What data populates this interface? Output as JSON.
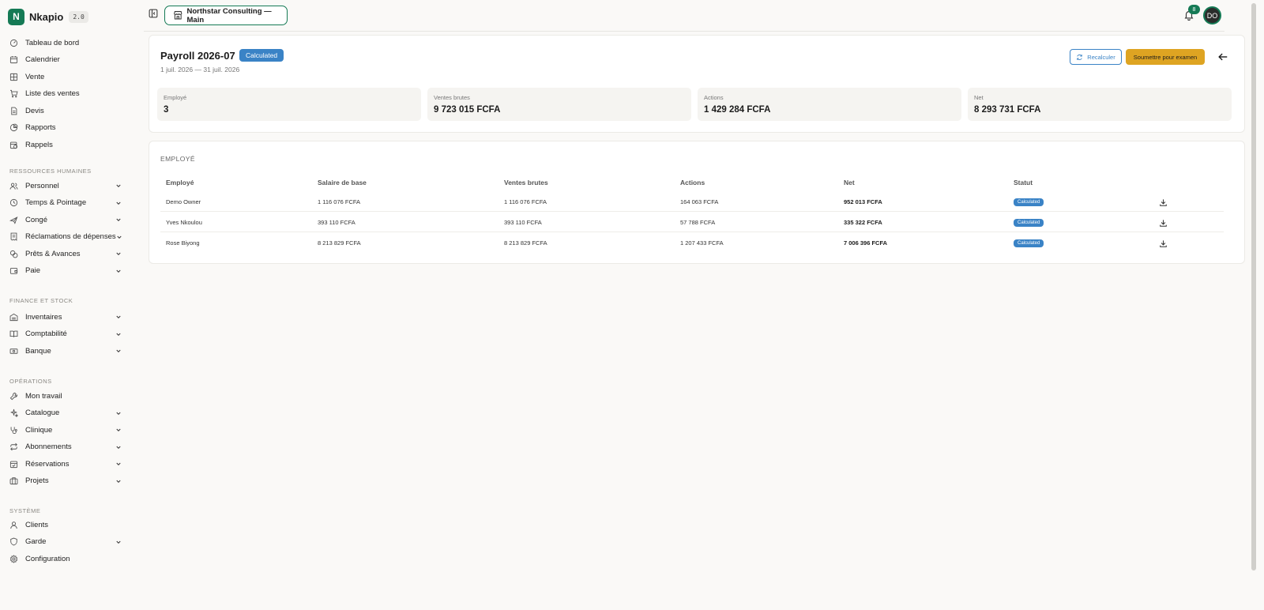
{
  "app": {
    "name": "Nkapio",
    "version": "2.0",
    "logo_letter": "N"
  },
  "sidebar": {
    "top_items": [
      {
        "label": "Tableau de bord",
        "icon": "dashboard-icon"
      },
      {
        "label": "Calendrier",
        "icon": "calendar-icon"
      },
      {
        "label": "Vente",
        "icon": "grid-icon"
      },
      {
        "label": "Liste des ventes",
        "icon": "cart-icon"
      },
      {
        "label": "Devis",
        "icon": "document-icon"
      },
      {
        "label": "Rapports",
        "icon": "pie-chart-icon"
      },
      {
        "label": "Rappels",
        "icon": "calendar-clock-icon"
      }
    ],
    "sections": [
      {
        "title": "Ressources humaines",
        "items": [
          {
            "label": "Personnel",
            "icon": "users-icon"
          },
          {
            "label": "Temps & Pointage",
            "icon": "clock-icon"
          },
          {
            "label": "Congé",
            "icon": "plane-icon"
          },
          {
            "label": "Réclamations de dépenses",
            "icon": "receipt-icon"
          },
          {
            "label": "Prêts & Avances",
            "icon": "coins-icon"
          },
          {
            "label": "Paie",
            "icon": "wallet-icon"
          }
        ]
      },
      {
        "title": "Finance et stock",
        "items": [
          {
            "label": "Inventaires",
            "icon": "warehouse-icon"
          },
          {
            "label": "Comptabilité",
            "icon": "book-icon"
          },
          {
            "label": "Banque",
            "icon": "banknote-icon"
          }
        ]
      },
      {
        "title": "Opérations",
        "items": [
          {
            "label": "Mon travail",
            "icon": "wrench-icon"
          },
          {
            "label": "Catalogue",
            "icon": "sparkles-icon"
          },
          {
            "label": "Clinique",
            "icon": "stethoscope-icon"
          },
          {
            "label": "Abonnements",
            "icon": "repeat-icon"
          },
          {
            "label": "Réservations",
            "icon": "calendar-check-icon"
          },
          {
            "label": "Projets",
            "icon": "briefcase-icon"
          }
        ]
      },
      {
        "title": "Système",
        "items": [
          {
            "label": "Clients",
            "icon": "user-icon"
          },
          {
            "label": "Garde",
            "icon": "shield-icon"
          },
          {
            "label": "Configuration",
            "icon": "gear-icon"
          }
        ]
      }
    ]
  },
  "topbar": {
    "organization": "Northstar Consulting — Main",
    "notification_count": "8",
    "avatar_initials": "DO"
  },
  "payroll": {
    "title": "Payroll 2026-07",
    "status": "Calculated",
    "date_range": "1 juil. 2026 — 31 juil. 2026",
    "recalc_label": "Recalculer",
    "submit_label": "Soumettre pour examen",
    "stats": [
      {
        "label": "Employé",
        "value": "3"
      },
      {
        "label": "Ventes brutes",
        "value": "9 723 015 FCFA"
      },
      {
        "label": "Actions",
        "value": "1 429 284 FCFA"
      },
      {
        "label": "Net",
        "value": "8 293 731 FCFA"
      }
    ]
  },
  "table": {
    "heading": "EMPLOYÉ",
    "columns": [
      "Employé",
      "Salaire de base",
      "Ventes brutes",
      "Actions",
      "Net",
      "Statut"
    ],
    "rows": [
      {
        "employee": "Demo Owner",
        "base": "1 116 076 FCFA",
        "gross": "1 116 076 FCFA",
        "actions": "164 063 FCFA",
        "net": "952 013 FCFA",
        "status": "Calculated"
      },
      {
        "employee": "Yves Nkoulou",
        "base": "393 110 FCFA",
        "gross": "393 110 FCFA",
        "actions": "57 788 FCFA",
        "net": "335 322 FCFA",
        "status": "Calculated"
      },
      {
        "employee": "Rose Biyong",
        "base": "8 213 829 FCFA",
        "gross": "8 213 829 FCFA",
        "actions": "1 207 433 FCFA",
        "net": "7 006 396 FCFA",
        "status": "Calculated"
      }
    ]
  }
}
